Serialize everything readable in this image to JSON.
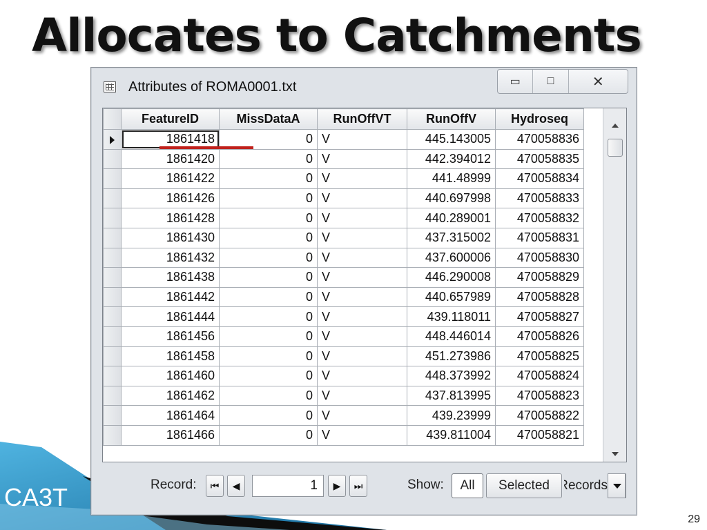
{
  "slide": {
    "title": "Allocates to Catchments",
    "brand": "CA3T",
    "page_number": "29"
  },
  "window": {
    "title": "Attributes of ROMA0001.txt",
    "icon": "table-icon",
    "buttons": {
      "minimize": "▭",
      "maximize": "□",
      "close": "✕"
    }
  },
  "table": {
    "columns": [
      "FeatureID",
      "MissDataA",
      "RunOffVT",
      "RunOffV",
      "Hydroseq"
    ],
    "rows": [
      [
        "1861418",
        "0",
        "V",
        "445.143005",
        "470058836"
      ],
      [
        "1861420",
        "0",
        "V",
        "442.394012",
        "470058835"
      ],
      [
        "1861422",
        "0",
        "V",
        "441.48999",
        "470058834"
      ],
      [
        "1861426",
        "0",
        "V",
        "440.697998",
        "470058833"
      ],
      [
        "1861428",
        "0",
        "V",
        "440.289001",
        "470058832"
      ],
      [
        "1861430",
        "0",
        "V",
        "437.315002",
        "470058831"
      ],
      [
        "1861432",
        "0",
        "V",
        "437.600006",
        "470058830"
      ],
      [
        "1861438",
        "0",
        "V",
        "446.290008",
        "470058829"
      ],
      [
        "1861442",
        "0",
        "V",
        "440.657989",
        "470058828"
      ],
      [
        "1861444",
        "0",
        "V",
        "439.118011",
        "470058827"
      ],
      [
        "1861456",
        "0",
        "V",
        "448.446014",
        "470058826"
      ],
      [
        "1861458",
        "0",
        "V",
        "451.273986",
        "470058825"
      ],
      [
        "1861460",
        "0",
        "V",
        "448.373992",
        "470058824"
      ],
      [
        "1861462",
        "0",
        "V",
        "437.813995",
        "470058823"
      ],
      [
        "1861464",
        "0",
        "V",
        "439.23999",
        "470058822"
      ],
      [
        "1861466",
        "0",
        "V",
        "439.811004",
        "470058821"
      ]
    ]
  },
  "footer": {
    "record_label": "Record:",
    "record_value": "1",
    "nav": {
      "first": "⏮",
      "prev": "◀",
      "next": "▶",
      "last": "⏭"
    },
    "show_label": "Show:",
    "all_label": "All",
    "selected_label": "Selected",
    "records_label": "Records"
  },
  "colors": {
    "annotation_strike": "#c0211c",
    "deco_blue": "#2a8fc4"
  }
}
